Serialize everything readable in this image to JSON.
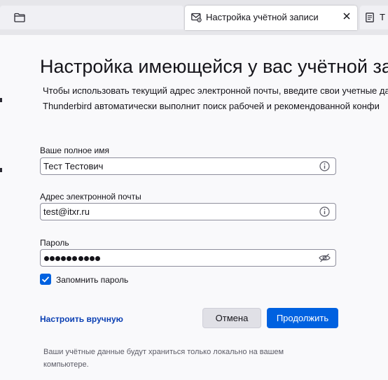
{
  "tabs": {
    "folder": {
      "icon": "folder-icon"
    },
    "active": {
      "icon": "mail-settings-icon",
      "label": "Настройка учётной записи",
      "close_icon": "close-icon"
    },
    "next": {
      "icon": "document-icon",
      "label": "Т"
    }
  },
  "main": {
    "title": "Настройка имеющейся у вас учётной запис",
    "description_line1": "Чтобы использовать текущий адрес электронной почты, введите свои учетные да",
    "description_line2": "Thunderbird автоматически выполнит поиск рабочей и рекомендованной конфи"
  },
  "form": {
    "name": {
      "label": "Ваше полное имя",
      "value": "Тест Тестович",
      "icon": "info-icon"
    },
    "email": {
      "label": "Адрес электронной почты",
      "value": "test@itxr.ru",
      "icon": "info-icon"
    },
    "password": {
      "label": "Пароль",
      "masked_length": 10,
      "icon": "eye-hidden-icon"
    },
    "remember": {
      "label": "Запомнить пароль",
      "checked": true
    }
  },
  "actions": {
    "manual_config": "Настроить вручную",
    "cancel": "Отмена",
    "continue": "Продолжить"
  },
  "footer": {
    "note_line1": "Ваши учётные данные будут храниться только локально на вашем",
    "note_line2": "компьютере."
  },
  "colors": {
    "accent": "#0061e0",
    "link": "#0a3fb3",
    "tabbar": "#e6e6ea",
    "background": "#f9f9fb"
  }
}
